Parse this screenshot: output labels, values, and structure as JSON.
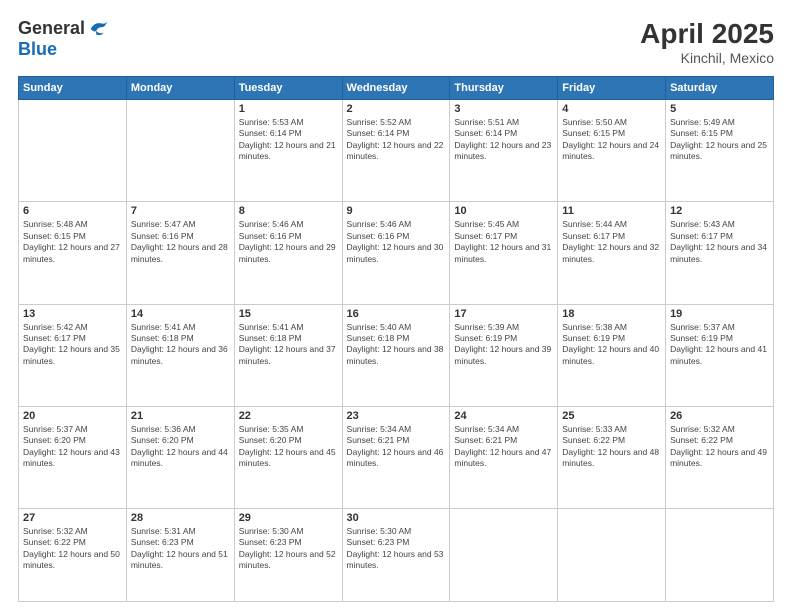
{
  "header": {
    "logo": {
      "line1": "General",
      "line2": "Blue"
    },
    "title": "April 2025",
    "subtitle": "Kinchil, Mexico"
  },
  "weekdays": [
    "Sunday",
    "Monday",
    "Tuesday",
    "Wednesday",
    "Thursday",
    "Friday",
    "Saturday"
  ],
  "weeks": [
    [
      {
        "day": "",
        "info": ""
      },
      {
        "day": "",
        "info": ""
      },
      {
        "day": "1",
        "info": "Sunrise: 5:53 AM\nSunset: 6:14 PM\nDaylight: 12 hours and 21 minutes."
      },
      {
        "day": "2",
        "info": "Sunrise: 5:52 AM\nSunset: 6:14 PM\nDaylight: 12 hours and 22 minutes."
      },
      {
        "day": "3",
        "info": "Sunrise: 5:51 AM\nSunset: 6:14 PM\nDaylight: 12 hours and 23 minutes."
      },
      {
        "day": "4",
        "info": "Sunrise: 5:50 AM\nSunset: 6:15 PM\nDaylight: 12 hours and 24 minutes."
      },
      {
        "day": "5",
        "info": "Sunrise: 5:49 AM\nSunset: 6:15 PM\nDaylight: 12 hours and 25 minutes."
      }
    ],
    [
      {
        "day": "6",
        "info": "Sunrise: 5:48 AM\nSunset: 6:15 PM\nDaylight: 12 hours and 27 minutes."
      },
      {
        "day": "7",
        "info": "Sunrise: 5:47 AM\nSunset: 6:16 PM\nDaylight: 12 hours and 28 minutes."
      },
      {
        "day": "8",
        "info": "Sunrise: 5:46 AM\nSunset: 6:16 PM\nDaylight: 12 hours and 29 minutes."
      },
      {
        "day": "9",
        "info": "Sunrise: 5:46 AM\nSunset: 6:16 PM\nDaylight: 12 hours and 30 minutes."
      },
      {
        "day": "10",
        "info": "Sunrise: 5:45 AM\nSunset: 6:17 PM\nDaylight: 12 hours and 31 minutes."
      },
      {
        "day": "11",
        "info": "Sunrise: 5:44 AM\nSunset: 6:17 PM\nDaylight: 12 hours and 32 minutes."
      },
      {
        "day": "12",
        "info": "Sunrise: 5:43 AM\nSunset: 6:17 PM\nDaylight: 12 hours and 34 minutes."
      }
    ],
    [
      {
        "day": "13",
        "info": "Sunrise: 5:42 AM\nSunset: 6:17 PM\nDaylight: 12 hours and 35 minutes."
      },
      {
        "day": "14",
        "info": "Sunrise: 5:41 AM\nSunset: 6:18 PM\nDaylight: 12 hours and 36 minutes."
      },
      {
        "day": "15",
        "info": "Sunrise: 5:41 AM\nSunset: 6:18 PM\nDaylight: 12 hours and 37 minutes."
      },
      {
        "day": "16",
        "info": "Sunrise: 5:40 AM\nSunset: 6:18 PM\nDaylight: 12 hours and 38 minutes."
      },
      {
        "day": "17",
        "info": "Sunrise: 5:39 AM\nSunset: 6:19 PM\nDaylight: 12 hours and 39 minutes."
      },
      {
        "day": "18",
        "info": "Sunrise: 5:38 AM\nSunset: 6:19 PM\nDaylight: 12 hours and 40 minutes."
      },
      {
        "day": "19",
        "info": "Sunrise: 5:37 AM\nSunset: 6:19 PM\nDaylight: 12 hours and 41 minutes."
      }
    ],
    [
      {
        "day": "20",
        "info": "Sunrise: 5:37 AM\nSunset: 6:20 PM\nDaylight: 12 hours and 43 minutes."
      },
      {
        "day": "21",
        "info": "Sunrise: 5:36 AM\nSunset: 6:20 PM\nDaylight: 12 hours and 44 minutes."
      },
      {
        "day": "22",
        "info": "Sunrise: 5:35 AM\nSunset: 6:20 PM\nDaylight: 12 hours and 45 minutes."
      },
      {
        "day": "23",
        "info": "Sunrise: 5:34 AM\nSunset: 6:21 PM\nDaylight: 12 hours and 46 minutes."
      },
      {
        "day": "24",
        "info": "Sunrise: 5:34 AM\nSunset: 6:21 PM\nDaylight: 12 hours and 47 minutes."
      },
      {
        "day": "25",
        "info": "Sunrise: 5:33 AM\nSunset: 6:22 PM\nDaylight: 12 hours and 48 minutes."
      },
      {
        "day": "26",
        "info": "Sunrise: 5:32 AM\nSunset: 6:22 PM\nDaylight: 12 hours and 49 minutes."
      }
    ],
    [
      {
        "day": "27",
        "info": "Sunrise: 5:32 AM\nSunset: 6:22 PM\nDaylight: 12 hours and 50 minutes."
      },
      {
        "day": "28",
        "info": "Sunrise: 5:31 AM\nSunset: 6:23 PM\nDaylight: 12 hours and 51 minutes."
      },
      {
        "day": "29",
        "info": "Sunrise: 5:30 AM\nSunset: 6:23 PM\nDaylight: 12 hours and 52 minutes."
      },
      {
        "day": "30",
        "info": "Sunrise: 5:30 AM\nSunset: 6:23 PM\nDaylight: 12 hours and 53 minutes."
      },
      {
        "day": "",
        "info": ""
      },
      {
        "day": "",
        "info": ""
      },
      {
        "day": "",
        "info": ""
      }
    ]
  ]
}
